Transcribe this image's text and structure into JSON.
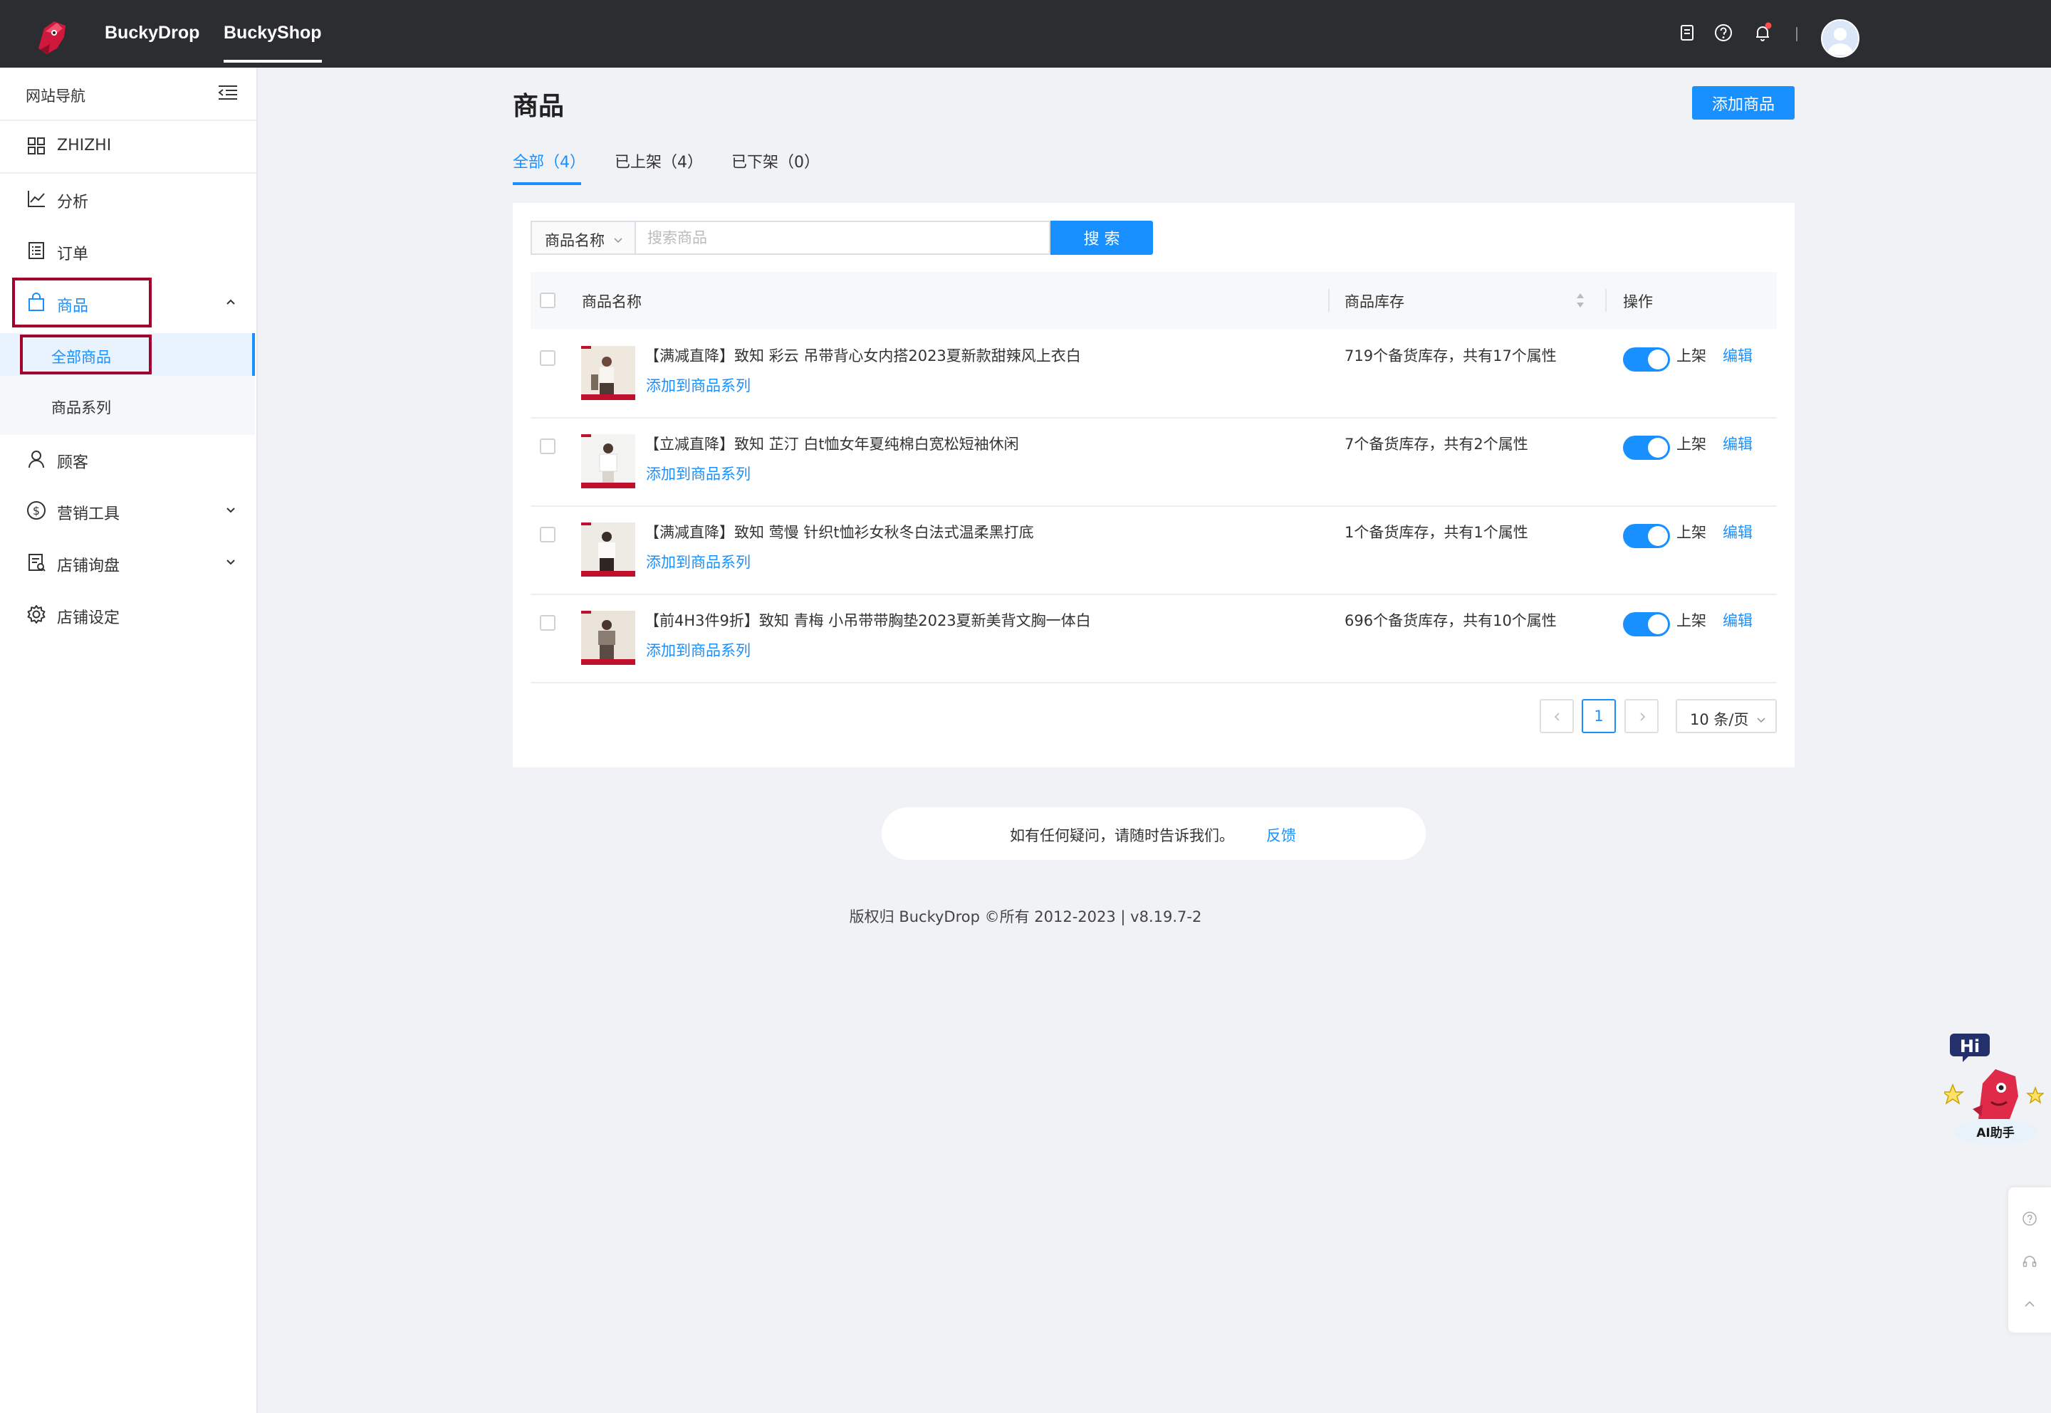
{
  "topbar": {
    "tabs": [
      {
        "label": "BuckyDrop",
        "active": false
      },
      {
        "label": "BuckyShop",
        "active": true
      }
    ],
    "icons": [
      "document-icon",
      "help-icon",
      "bell-icon"
    ],
    "notification_dot_color": "#ff4d4f"
  },
  "sidebar": {
    "header_label": "网站导航",
    "items": [
      {
        "label": "ZHIZHI",
        "icon": "dashboard-icon"
      },
      {
        "label": "分析",
        "icon": "chart-icon"
      },
      {
        "label": "订单",
        "icon": "order-icon"
      },
      {
        "label": "商品",
        "icon": "bag-icon",
        "expanded": true,
        "active": true,
        "children": [
          {
            "label": "全部商品",
            "active": true
          },
          {
            "label": "商品系列",
            "active": false
          }
        ]
      },
      {
        "label": "顾客",
        "icon": "user-icon"
      },
      {
        "label": "营销工具",
        "icon": "dollar-icon",
        "has_submenu": true
      },
      {
        "label": "店铺询盘",
        "icon": "inquiry-icon",
        "has_submenu": true
      },
      {
        "label": "店铺设定",
        "icon": "gear-icon"
      }
    ]
  },
  "main": {
    "title": "商品",
    "add_button": "添加商品",
    "tabs": [
      {
        "label": "全部（4）",
        "active": true
      },
      {
        "label": "已上架（4）",
        "active": false
      },
      {
        "label": "已下架（0）",
        "active": false
      }
    ],
    "search": {
      "field_select": "商品名称",
      "placeholder": "搜索商品",
      "button": "搜 索"
    },
    "table": {
      "headers": {
        "name": "商品名称",
        "stock": "商品库存",
        "action": "操作"
      },
      "rows": [
        {
          "name": "【满减直降】致知 彩云 吊带背心女内搭2023夏新款甜辣风上衣白",
          "add_link": "添加到商品系列",
          "stock": "719个备货库存，共有17个属性",
          "status": "上架",
          "enabled": true,
          "edit": "编辑"
        },
        {
          "name": "【立减直降】致知 芷汀 白t恤女年夏纯棉白宽松短袖休闲",
          "add_link": "添加到商品系列",
          "stock": "7个备货库存，共有2个属性",
          "status": "上架",
          "enabled": true,
          "edit": "编辑"
        },
        {
          "name": "【满减直降】致知 莺慢 针织t恤衫女秋冬白法式温柔黑打底",
          "add_link": "添加到商品系列",
          "stock": "1个备货库存，共有1个属性",
          "status": "上架",
          "enabled": true,
          "edit": "编辑"
        },
        {
          "name": "【前4H3件9折】致知 青梅 小吊带带胸垫2023夏新美背文胸一体白",
          "add_link": "添加到商品系列",
          "stock": "696个备货库存，共有10个属性",
          "status": "上架",
          "enabled": true,
          "edit": "编辑"
        }
      ]
    },
    "pagination": {
      "current_page": "1",
      "page_size": "10 条/页"
    }
  },
  "footer": {
    "feedback_text": "如有任何疑问，请随时告诉我们。",
    "feedback_link": "反馈",
    "copyright": "版权归 BuckyDrop ©所有 2012-2023 | v8.19.7-2"
  },
  "ai_assistant": {
    "badge": "Hi",
    "label": "AI助手"
  },
  "colors": {
    "primary": "#1890ff",
    "topbar": "#2b2d30",
    "highlight_box": "#a3002c",
    "page_bg": "#f0f2f5"
  }
}
